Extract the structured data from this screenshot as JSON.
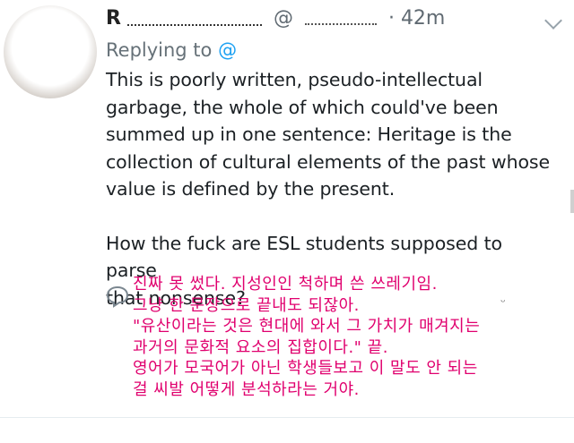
{
  "header": {
    "name": "R",
    "handle_prefix": "@",
    "timestamp": "· 42m"
  },
  "replying": {
    "label": "Replying to",
    "handle": "@"
  },
  "tweet": {
    "lines": [
      "This is poorly written, pseudo-intellectual",
      "garbage, the whole of which could've been",
      "summed up in one sentence: Heritage is the",
      "collection of cultural elements of the past whose",
      "value is defined by the present."
    ],
    "lines2": [
      "How the fuck are ESL students supposed to parse",
      "that nonsense?"
    ]
  },
  "korean": [
    "진짜 못 썼다. 지성인인 척하며 쓴 쓰레기임.",
    "그냥 한 문장으로 끝내도 되잖아.",
    "\"유산이라는 것은 현대에 와서 그 가치가 매겨지는",
    "과거의 문화적 요소의 집합이다.\" 끝.",
    "영어가 모국어가 아닌 학생들보고 이 말도 안 되는",
    "걸 씨발 어떻게 분석하라는 거야."
  ],
  "icons": {
    "reply": "reply-icon",
    "menu": "chevron-down-icon"
  },
  "colors": {
    "link": "#1da1f2",
    "annotation": "#e0006e",
    "muted": "#667178"
  }
}
